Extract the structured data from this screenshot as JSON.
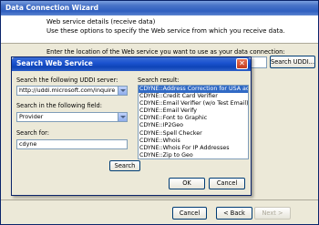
{
  "wizard": {
    "title": "Data Connection Wizard",
    "header_line1": "Web service details (receive data)",
    "header_line2": "Use these options to specify the Web service from which you receive data.",
    "prompt": "Enter the location of the Web service you want to use as your data connection:",
    "search_uddi_label": "Search UDDI...",
    "cancel_label": "Cancel",
    "back_label": "< Back",
    "next_label": "Next >"
  },
  "dialog": {
    "title": "Search Web Service",
    "server_label": "Search the following UDDI server:",
    "server_value": "http://uddi.microsoft.com/inquire",
    "field_label": "Search in the following field:",
    "field_value": "Provider",
    "for_label": "Search for:",
    "for_value": "cdyne",
    "search_button": "Search",
    "results_label": "Search result:",
    "results": [
      "CDYNE::Address Correction for USA addre",
      "CDYNE::Credit Card Verifier",
      "CDYNE::Email Verifier (w/o Test Email)",
      "CDYNE::Email Verify",
      "CDYNE::Font to Graphic",
      "CDYNE::IP2Geo",
      "CDYNE::Spell Checker",
      "CDYNE::Whois",
      "CDYNE::Whois For IP Addresses",
      "CDYNE::Zip to Geo"
    ],
    "ok_label": "OK",
    "cancel_label": "Cancel"
  }
}
